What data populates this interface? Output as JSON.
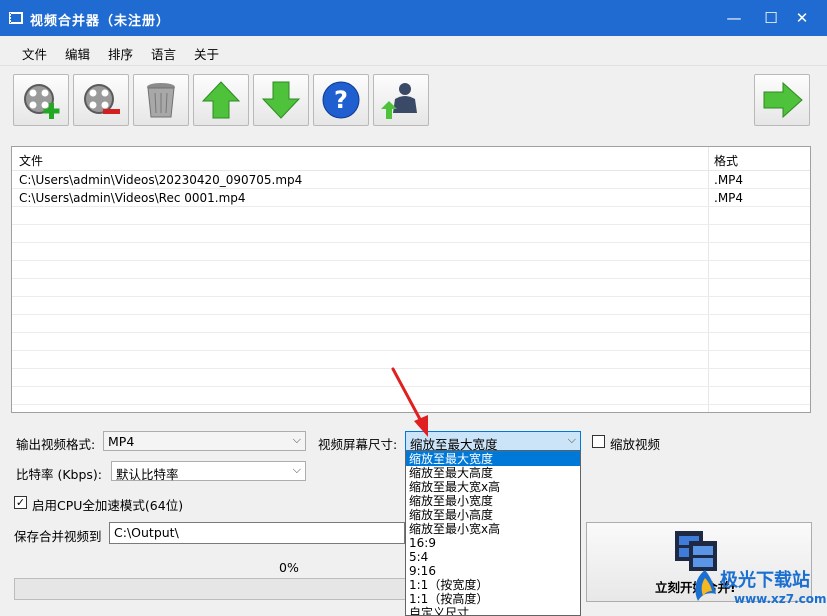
{
  "window": {
    "title": "视频合并器（未注册）",
    "minimize": "—",
    "maximize": "☐",
    "close": "✕"
  },
  "menu": [
    "文件",
    "编辑",
    "排序",
    "语言",
    "关于"
  ],
  "toolbar": [
    "add-video-icon",
    "remove-video-icon",
    "clear-list-icon",
    "move-up-icon",
    "move-down-icon",
    "help-icon",
    "register-icon",
    "next-icon"
  ],
  "file_list": {
    "columns": [
      "文件",
      "格式"
    ],
    "rows": [
      {
        "file": "C:\\Users\\admin\\Videos\\20230420_090705.mp4",
        "format": ".MP4"
      },
      {
        "file": "C:\\Users\\admin\\Videos\\Rec 0001.mp4",
        "format": ".MP4"
      }
    ]
  },
  "settings": {
    "output_format_label": "输出视频格式:",
    "output_format_value": "MP4",
    "screen_size_label": "视频屏幕尺寸:",
    "screen_size_value": "缩放至最大宽度",
    "scale_video_label": "缩放视频",
    "bitrate_label": "比特率 (Kbps):",
    "bitrate_value": "默认比特率",
    "cpu_accel_label": "启用CPU全加速模式(64位)",
    "save_label": "保存合并视频到",
    "save_path": "C:\\Output\\"
  },
  "dropdown_options": [
    "缩放至最大宽度",
    "缩放至最大高度",
    "缩放至最大宽x高",
    "缩放至最小宽度",
    "缩放至最小高度",
    "缩放至最小宽x高",
    "16:9",
    "5:4",
    "9:16",
    "1:1（按宽度）",
    "1:1（按高度）",
    "自定义尺寸"
  ],
  "dropdown_selected_index": 0,
  "progress": {
    "percent_text": "0%",
    "value": 0
  },
  "merge_button": "立刻开始合并!",
  "watermark": {
    "title": "极光下载站",
    "subtitle": "www.xz7.com"
  },
  "colors": {
    "titlebar": "#1f6bd1",
    "selection": "#0078d7",
    "arrow": "#e02020"
  }
}
